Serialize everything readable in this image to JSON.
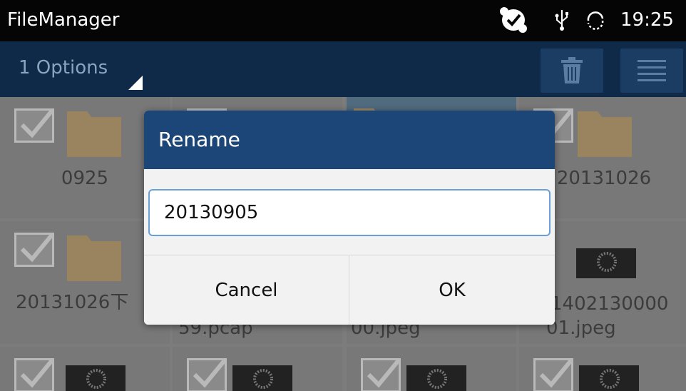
{
  "statusbar": {
    "app_title": "FileManager",
    "time": "19:25",
    "icons": [
      "skype-icon",
      "usb-icon",
      "sync-icon"
    ]
  },
  "actionbar": {
    "options_label": "1 Options",
    "buttons": [
      "trash-icon",
      "menu-icon"
    ]
  },
  "grid": {
    "items": [
      {
        "name": "0925",
        "type": "folder"
      },
      {
        "name": "",
        "type": "folder"
      },
      {
        "name": "",
        "type": "folder",
        "selected": true
      },
      {
        "name": "20131026",
        "type": "folder"
      },
      {
        "name": "20131026下",
        "type": "folder"
      },
      {
        "name": "59.pcap",
        "type": "file"
      },
      {
        "name": "00.jpeg",
        "type": "image"
      },
      {
        "name": "1402130000",
        "name2": "01.jpeg",
        "type": "image"
      },
      {
        "name": "",
        "type": "image"
      },
      {
        "name": "",
        "type": "image"
      },
      {
        "name": "",
        "type": "image"
      },
      {
        "name": "",
        "type": "image"
      }
    ]
  },
  "dialog": {
    "title": "Rename",
    "input_value": "20130905",
    "cancel_label": "Cancel",
    "ok_label": "OK"
  },
  "colors": {
    "actionbar": "#0f2a48",
    "dialog_header": "#1c4677",
    "input_border": "#6aa0d8",
    "folder": "#d2b07a"
  }
}
